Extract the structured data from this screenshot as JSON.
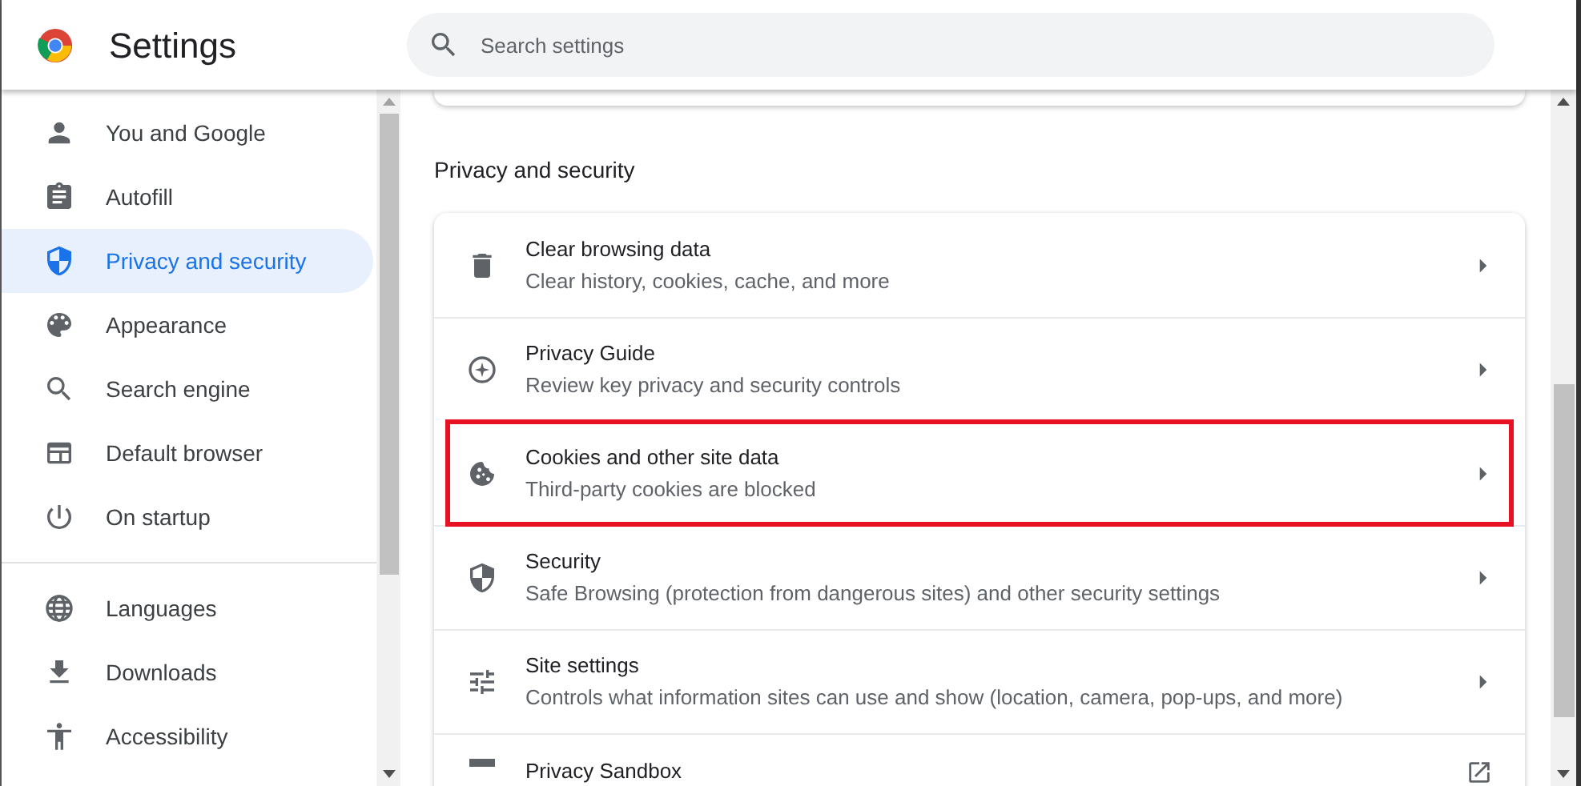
{
  "header": {
    "title": "Settings",
    "search": {
      "placeholder": "Search settings"
    }
  },
  "sidebar": {
    "items": [
      {
        "label": "You and Google",
        "selected": false
      },
      {
        "label": "Autofill",
        "selected": false
      },
      {
        "label": "Privacy and security",
        "selected": true
      },
      {
        "label": "Appearance",
        "selected": false
      },
      {
        "label": "Search engine",
        "selected": false
      },
      {
        "label": "Default browser",
        "selected": false
      },
      {
        "label": "On startup",
        "selected": false
      },
      {
        "kind": "divider"
      },
      {
        "label": "Languages",
        "selected": false
      },
      {
        "label": "Downloads",
        "selected": false
      },
      {
        "label": "Accessibility",
        "selected": false
      }
    ]
  },
  "section": {
    "heading": "Privacy and security",
    "rows": [
      {
        "title": "Clear browsing data",
        "subtitle": "Clear history, cookies, cache, and more",
        "kind": "subpage",
        "highlighted": false
      },
      {
        "title": "Privacy Guide",
        "subtitle": "Review key privacy and security controls",
        "kind": "subpage",
        "highlighted": false
      },
      {
        "title": "Cookies and other site data",
        "subtitle": "Third-party cookies are blocked",
        "kind": "subpage",
        "highlighted": true
      },
      {
        "title": "Security",
        "subtitle": "Safe Browsing (protection from dangerous sites) and other security settings",
        "kind": "subpage",
        "highlighted": false
      },
      {
        "title": "Site settings",
        "subtitle": "Controls what information sites can use and show (location, camera, pop-ups, and more)",
        "kind": "subpage",
        "highlighted": false
      },
      {
        "title": "Privacy Sandbox",
        "kind": "external",
        "highlighted": false
      }
    ]
  }
}
